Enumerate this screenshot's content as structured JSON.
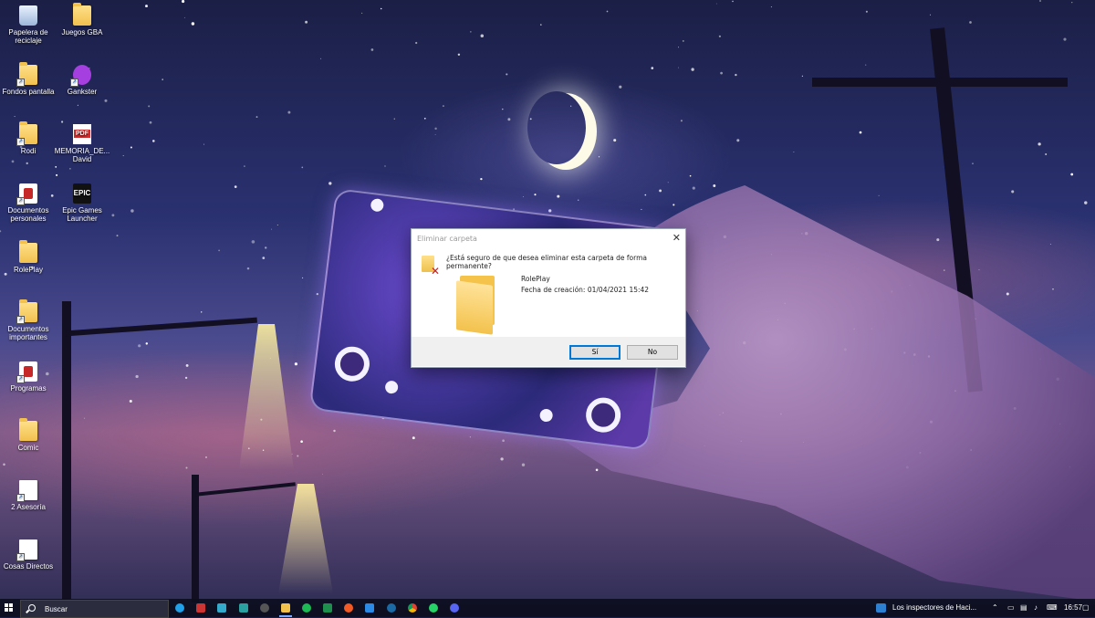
{
  "desktop_icons": [
    {
      "label": "Papelera de reciclaje",
      "icon": "recycle-bin-icon"
    },
    {
      "label": "Juegos GBA",
      "icon": "folder-icon"
    },
    {
      "label": "Fondos pantalla",
      "icon": "folder-shortcut-icon"
    },
    {
      "label": "Gankster",
      "icon": "gankster-icon"
    },
    {
      "label": "Rodi",
      "icon": "folder-shortcut-icon"
    },
    {
      "label": "MEMORIA_DE... David",
      "icon": "pdf-icon"
    },
    {
      "label": "Documentos personales",
      "icon": "app-shortcut-icon"
    },
    {
      "label": "Epic Games Launcher",
      "icon": "epic-games-icon"
    },
    {
      "label": "RolePlay",
      "icon": "folder-icon"
    },
    {
      "label": "Documentos importantes",
      "icon": "folder-shortcut-icon"
    },
    {
      "label": "Programas",
      "icon": "app-shortcut-icon"
    },
    {
      "label": "Comic",
      "icon": "folder-icon"
    },
    {
      "label": "2 Asesoría",
      "icon": "file-shortcut-icon"
    },
    {
      "label": "Cosas Directos",
      "icon": "file-shortcut-icon"
    }
  ],
  "dialog": {
    "title": "Eliminar carpeta",
    "close_glyph": "✕",
    "question": "¿Está seguro de que desea eliminar esta carpeta de forma permanente?",
    "item_name": "RolePlay",
    "item_date": "Fecha de creación: 01/04/2021 15:42",
    "yes_label": "Sí",
    "no_label": "No"
  },
  "taskbar": {
    "search_placeholder": "Buscar",
    "notification": "Los inspectores de Haci...",
    "time": "16:57",
    "pinned_apps": [
      "edge-icon",
      "apps-icon",
      "store-icon",
      "maps-icon",
      "chrome-circle-icon",
      "file-explorer-icon",
      "spotify-icon",
      "sheets-icon",
      "brave-icon",
      "network-icon",
      "steam-icon",
      "chrome-icon",
      "whatsapp-icon",
      "discord-icon"
    ]
  },
  "colors": {
    "accent": "#0078d7",
    "dialog_footer": "#f0f0f0",
    "taskbar": "#0c0e1e"
  }
}
